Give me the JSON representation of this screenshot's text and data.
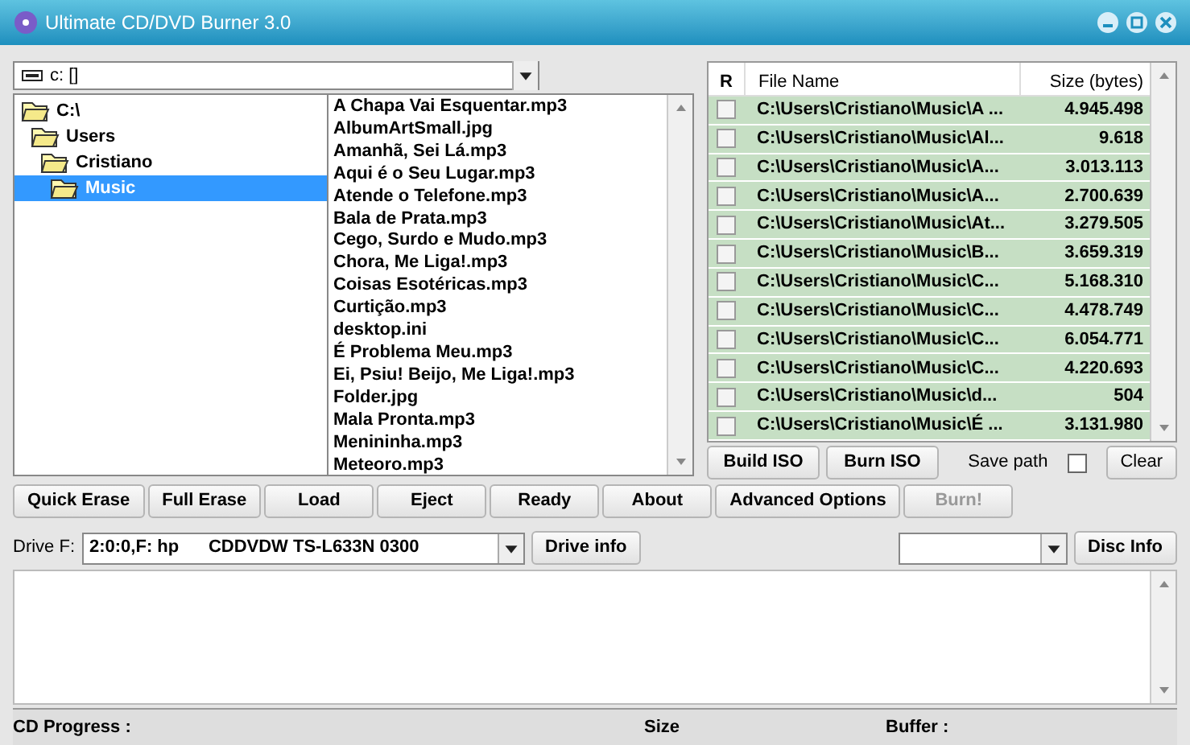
{
  "window": {
    "title": "Ultimate CD/DVD Burner 3.0"
  },
  "drive_selector": {
    "value": "c: []"
  },
  "folder_tree": [
    {
      "label": "C:\\",
      "selected": false,
      "children": [
        {
          "label": "Users",
          "selected": false,
          "children": [
            {
              "label": "Cristiano",
              "selected": false,
              "children": [
                {
                  "label": "Music",
                  "selected": true
                }
              ]
            }
          ]
        }
      ]
    }
  ],
  "files": [
    "A Chapa Vai Esquentar.mp3",
    "AlbumArtSmall.jpg",
    "Amanhã, Sei Lá.mp3",
    "Aqui é o Seu Lugar.mp3",
    "Atende o Telefone.mp3",
    "Bala de Prata.mp3",
    "Cego, Surdo e Mudo.mp3",
    "Chora, Me Liga!.mp3",
    "Coisas Esotéricas.mp3",
    "Curtição.mp3",
    "desktop.ini",
    "É Problema Meu.mp3",
    "Ei, Psiu! Beijo, Me Liga!.mp3",
    "Folder.jpg",
    "Mala Pronta.mp3",
    "Menininha.mp3",
    "Meteoro.mp3"
  ],
  "table": {
    "columns": [
      "R",
      "File Name",
      "Size (bytes)"
    ],
    "rows": [
      {
        "checked": false,
        "name": "C:\\Users\\Cristiano\\Music\\A ...",
        "size": "4.945.498"
      },
      {
        "checked": false,
        "name": "C:\\Users\\Cristiano\\Music\\Al...",
        "size": "9.618"
      },
      {
        "checked": false,
        "name": "C:\\Users\\Cristiano\\Music\\A...",
        "size": "3.013.113"
      },
      {
        "checked": false,
        "name": "C:\\Users\\Cristiano\\Music\\A...",
        "size": "2.700.639"
      },
      {
        "checked": false,
        "name": "C:\\Users\\Cristiano\\Music\\At...",
        "size": "3.279.505"
      },
      {
        "checked": false,
        "name": "C:\\Users\\Cristiano\\Music\\B...",
        "size": "3.659.319"
      },
      {
        "checked": false,
        "name": "C:\\Users\\Cristiano\\Music\\C...",
        "size": "5.168.310"
      },
      {
        "checked": false,
        "name": "C:\\Users\\Cristiano\\Music\\C...",
        "size": "4.478.749"
      },
      {
        "checked": false,
        "name": "C:\\Users\\Cristiano\\Music\\C...",
        "size": "6.054.771"
      },
      {
        "checked": false,
        "name": "C:\\Users\\Cristiano\\Music\\C...",
        "size": "4.220.693"
      },
      {
        "checked": false,
        "name": "C:\\Users\\Cristiano\\Music\\d...",
        "size": "504"
      },
      {
        "checked": false,
        "name": "C:\\Users\\Cristiano\\Music\\É ...",
        "size": "3.131.980"
      }
    ]
  },
  "iso_buttons": [
    "Build ISO",
    "Burn ISO"
  ],
  "save_path": {
    "label": "Save path",
    "checked": false
  },
  "clear_button": "Clear",
  "actions": [
    {
      "label": "Quick Erase",
      "disabled": false
    },
    {
      "label": "Full Erase",
      "disabled": false
    },
    {
      "label": "Load",
      "disabled": false
    },
    {
      "label": "Eject",
      "disabled": false
    },
    {
      "label": "Ready",
      "disabled": false
    },
    {
      "label": "About",
      "disabled": false
    },
    {
      "label": "Advanced Options",
      "disabled": false
    },
    {
      "label": "Burn!",
      "disabled": true
    }
  ],
  "drive": {
    "label": "Drive F:",
    "value": "2:0:0,F: hp      CDDVDW TS-L633N 0300",
    "info_button": "Drive info"
  },
  "disc_info_button": "Disc Info",
  "status_bar": [
    "CD Progress :",
    "Size",
    "Buffer :"
  ]
}
